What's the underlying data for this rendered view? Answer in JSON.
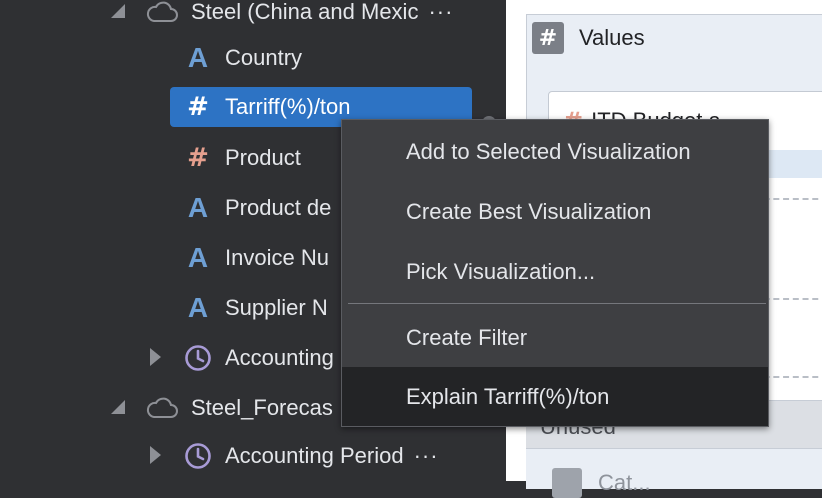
{
  "tree": {
    "items": [
      {
        "label": "Steel (China and Mexic",
        "ellipsis": "···"
      },
      {
        "label": "Country"
      },
      {
        "label": "Tarriff(%)/ton"
      },
      {
        "label": "Product"
      },
      {
        "label": "Product de"
      },
      {
        "label": "Invoice Nu"
      },
      {
        "label": "Supplier N"
      },
      {
        "label": "Accounting"
      },
      {
        "label": "Steel_Forecas"
      },
      {
        "label": "Accounting Period",
        "ellipsis": "···"
      }
    ]
  },
  "viz": {
    "values_label": "Values",
    "pill_label": "ITD Budget a...",
    "unused_label": "Unused",
    "lower_label": "Cat..."
  },
  "menu": {
    "items": [
      {
        "label": "Add to Selected Visualization"
      },
      {
        "label": "Create Best Visualization"
      },
      {
        "label": "Pick Visualization..."
      },
      {
        "label": "Create Filter"
      },
      {
        "label": "Explain Tarriff(%)/ton"
      }
    ]
  },
  "colors": {
    "selection": "#2d73c4",
    "attribute_icon": "#6e9fd4",
    "measure_icon": "#e59f8e",
    "menu_bg": "#3e3f42",
    "menu_highlight": "#232426"
  }
}
